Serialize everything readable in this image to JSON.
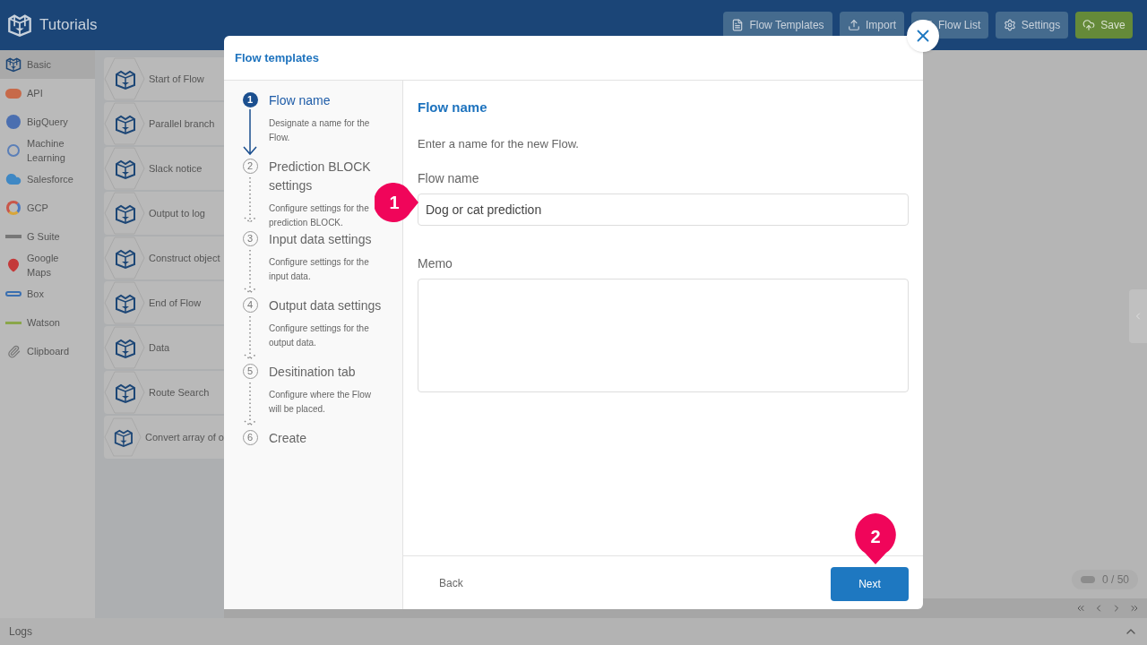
{
  "app": {
    "title": "Tutorials"
  },
  "toolbar": [
    {
      "label": "Flow Templates",
      "kind": "templates"
    },
    {
      "label": "Import",
      "kind": "import"
    },
    {
      "label": "Flow List",
      "kind": "list"
    },
    {
      "label": "Settings",
      "kind": "settings"
    },
    {
      "label": "Save",
      "kind": "save"
    }
  ],
  "categories": [
    {
      "label": "Basic",
      "kind": "basic",
      "selected": true
    },
    {
      "label": "API",
      "kind": "api",
      "selected": false
    },
    {
      "label": "BigQuery",
      "kind": "bigquery",
      "selected": false
    },
    {
      "label": "Machine Learning",
      "kind": "ml",
      "selected": false
    },
    {
      "label": "Salesforce",
      "kind": "salesforce",
      "selected": false
    },
    {
      "label": "GCP",
      "kind": "gcp",
      "selected": false
    },
    {
      "label": "G Suite",
      "kind": "gsuite",
      "selected": false
    },
    {
      "label": "Google Maps",
      "kind": "maps",
      "selected": false
    },
    {
      "label": "Box",
      "kind": "box",
      "selected": false
    },
    {
      "label": "Watson",
      "kind": "watson",
      "selected": false
    },
    {
      "label": "Clipboard",
      "kind": "clipboard",
      "selected": false
    }
  ],
  "blocks": [
    "Start of Flow",
    "Parallel branch",
    "Slack notice",
    "Output to log",
    "Construct object",
    "End of Flow",
    "Data",
    "Route Search",
    "Convert array of o"
  ],
  "counter": "0 / 50",
  "logs": "Logs",
  "dialog": {
    "title": "Flow templates",
    "steps": [
      {
        "number": "1",
        "title": "Flow name",
        "description": "Designate a name for the Flow.",
        "selected": true
      },
      {
        "number": "2",
        "title": "Prediction BLOCK settings",
        "description": "Configure settings for the prediction BLOCK.",
        "selected": false
      },
      {
        "number": "3",
        "title": "Input data settings",
        "description": "Configure settings for the input data.",
        "selected": false
      },
      {
        "number": "4",
        "title": "Output data settings",
        "description": "Configure settings for the output data.",
        "selected": false
      },
      {
        "number": "5",
        "title": "Desitination tab",
        "description": "Configure where the Flow will be placed.",
        "selected": false
      },
      {
        "number": "6",
        "title": "Create",
        "selected": false
      }
    ],
    "heading": "Flow name",
    "intro": "Enter a name for the new Flow.",
    "name_label": "Flow name",
    "name_value": "Dog or cat prediction",
    "memo_label": "Memo",
    "back": "Back",
    "next": "Next"
  },
  "callouts": [
    {
      "number": "1",
      "kind": "left"
    },
    {
      "number": "2",
      "kind": "down"
    }
  ]
}
